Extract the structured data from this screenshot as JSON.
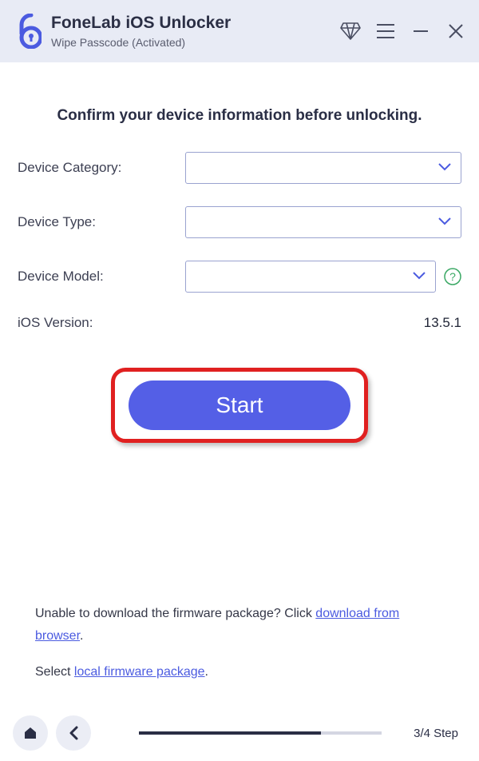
{
  "header": {
    "title": "FoneLab iOS Unlocker",
    "subtitle": "Wipe Passcode  (Activated)"
  },
  "main": {
    "heading": "Confirm your device information before unlocking.",
    "fields": {
      "category_label": "Device Category:",
      "category_value": "",
      "type_label": "Device Type:",
      "type_value": "",
      "model_label": "Device Model:",
      "model_value": "",
      "ios_label": "iOS Version:",
      "ios_value": "13.5.1"
    },
    "start_label": "Start"
  },
  "bottom": {
    "line1a": "Unable to download the firmware package? Click ",
    "link1": "download from browser",
    "line1b": ".",
    "line2a": "Select ",
    "link2": "local firmware package",
    "line2b": "."
  },
  "footer": {
    "step_label": "3/4 Step",
    "progress_pct": 75
  }
}
